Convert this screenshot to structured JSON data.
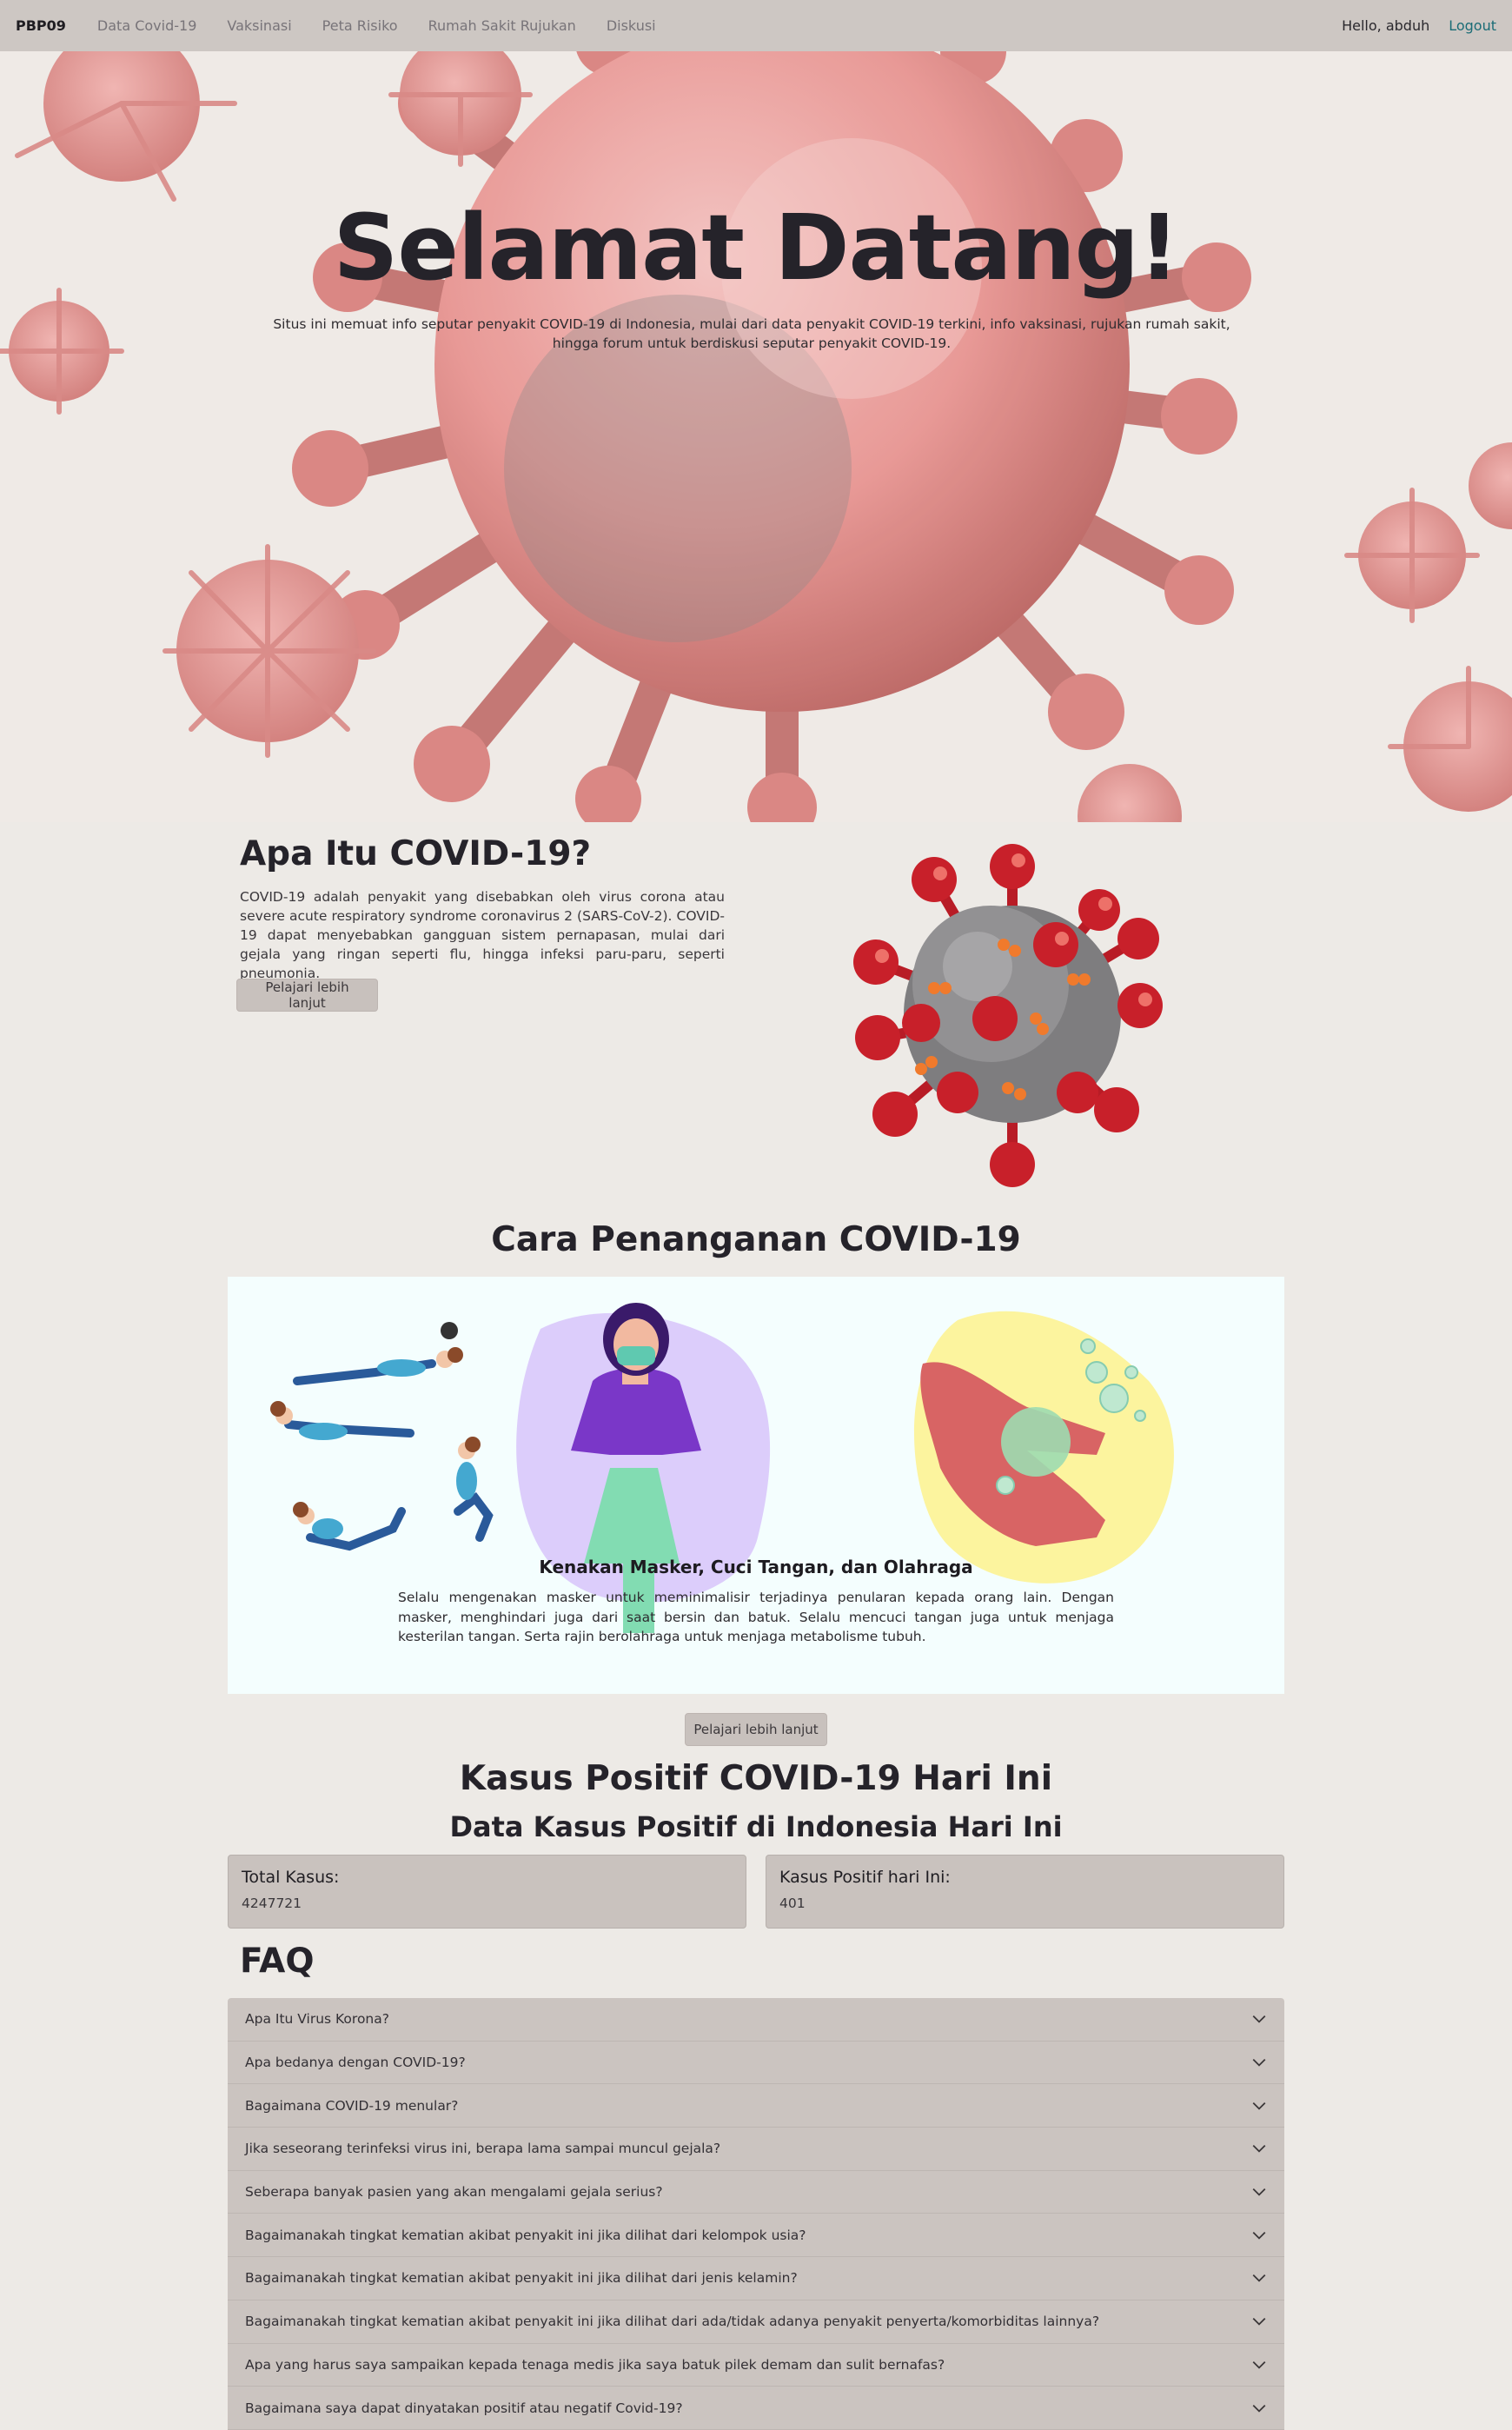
{
  "navbar": {
    "brand": "PBP09",
    "links": [
      "Data Covid-19",
      "Vaksinasi",
      "Peta Risiko",
      "Rumah Sakit Rujukan",
      "Diskusi"
    ],
    "greeting": "Hello, abduh",
    "logout": "Logout"
  },
  "hero": {
    "title": "Selamat Datang!",
    "subtitle": "Situs ini memuat info seputar penyakit COVID-19 di Indonesia, mulai dari data penyakit COVID-19 terkini, info vaksinasi, rujukan rumah sakit, hingga forum untuk berdiskusi seputar penyakit COVID-19."
  },
  "about": {
    "title": "Apa Itu COVID-19?",
    "text": "COVID-19 adalah penyakit yang disebabkan oleh virus corona atau severe acute respiratory syndrome coronavirus 2 (SARS-CoV-2). COVID-19 dapat menyebabkan gangguan sistem pernapasan, mulai dari gejala yang ringan seperti flu, hingga infeksi paru-paru, seperti pneumonia.",
    "button": "Pelajari lebih lanjut"
  },
  "handling": {
    "title": "Cara Penanganan COVID-19",
    "caption_title": "Kenakan Masker, Cuci Tangan, dan Olahraga",
    "caption_text": "Selalu mengenakan masker untuk meminimalisir terjadinya penularan kepada orang lain. Dengan masker, menghindari juga dari saat bersin dan batuk. Selalu mencuci tangan juga untuk menjaga kesterilan tangan. Serta rajin berolahraga untuk menjaga metabolisme tubuh.",
    "button": "Pelajari lebih lanjut"
  },
  "cases": {
    "title": "Kasus Positif COVID-19 Hari Ini",
    "subtitle": "Data Kasus Positif di Indonesia Hari Ini",
    "total_label": "Total Kasus:",
    "total_value": "4247721",
    "today_label": "Kasus Positif hari Ini:",
    "today_value": "401"
  },
  "faq": {
    "title": "FAQ",
    "items": [
      "Apa Itu Virus Korona?",
      "Apa bedanya dengan COVID-19?",
      "Bagaimana COVID-19 menular?",
      "Jika seseorang terinfeksi virus ini, berapa lama sampai muncul gejala?",
      "Seberapa banyak pasien yang akan mengalami gejala serius?",
      "Bagaimanakah tingkat kematian akibat penyakit ini jika dilihat dari kelompok usia?",
      "Bagaimanakah tingkat kematian akibat penyakit ini jika dilihat dari jenis kelamin?",
      "Bagaimanakah tingkat kematian akibat penyakit ini jika dilihat dari ada/tidak adanya penyakit penyerta/komorbiditas lainnya?",
      "Apa yang harus saya sampaikan kepada tenaga medis jika saya batuk pilek demam dan sulit bernafas?",
      "Bagaimana saya dapat dinyatakan positif atau negatif Covid-19?"
    ]
  },
  "colors": {
    "navbar_bg": "#cdc7c3",
    "page_bg": "#edeae6",
    "card_bg": "#c9c2be",
    "logout_link": "#1a6c76",
    "carousel_bg": "#f4fefe",
    "virus_red": "#c8202a"
  }
}
